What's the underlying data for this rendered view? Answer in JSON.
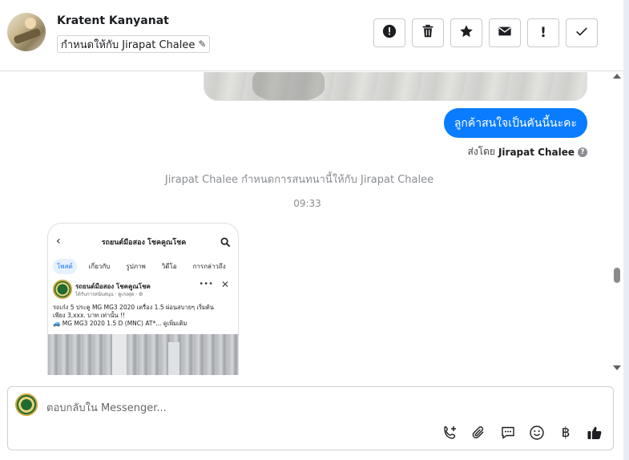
{
  "contact": {
    "name": "Kratent Kanyanat",
    "assign_label": "กำหนดให้กับ Jirapat Chalee"
  },
  "actions": [
    {
      "name": "spam-button",
      "icon": "alert-circle-icon"
    },
    {
      "name": "delete-button",
      "icon": "trash-icon"
    },
    {
      "name": "star-button",
      "icon": "star-icon"
    },
    {
      "name": "mark-unread-button",
      "icon": "envelope-icon"
    },
    {
      "name": "important-button",
      "icon": "exclamation-icon"
    },
    {
      "name": "done-button",
      "icon": "check-icon"
    }
  ],
  "messages": {
    "outgoing_text": "ลูกค้าสนใจเป็นคันนี้นะคะ",
    "sent_by_prefix": "ส่งโดย",
    "sent_by_name": "Jirapat Chalee",
    "system_note": "Jirapat Chalee กำหนดการสนทนานี้ให้กับ Jirapat Chalee",
    "timestamp": "09:33"
  },
  "shared_post": {
    "header_title": "รถยนต์มือสอง โชคคูณโชค",
    "tabs": [
      "โพสต์",
      "เกี่ยวกับ",
      "รูปภาพ",
      "วิดีโอ",
      "การกล่าวถึง"
    ],
    "page_name": "รถยนต์มือสอง โชคคูณโชค",
    "page_sub": "ได้รับการสนับสนุน · ดูเก่งสุด · ⚙",
    "text_line1": "รถเก๋ง 5 ประตู MG MG3 2020 เครื่อง 1.5 ผ่อนสบายๆ เริ่มต้น",
    "text_line2": "เพียง 3,xxx. บาท เท่านั้น !!",
    "text_line3": "🚙 MG MG3 2020 1.5 D (MNC) AT*... ดูเพิ่มเติม"
  },
  "composer": {
    "placeholder": "ตอบกลับใน Messenger..."
  },
  "composer_tools": [
    "add-call-icon",
    "attachment-icon",
    "saved-replies-icon",
    "emoji-icon",
    "baht-icon",
    "like-icon"
  ]
}
